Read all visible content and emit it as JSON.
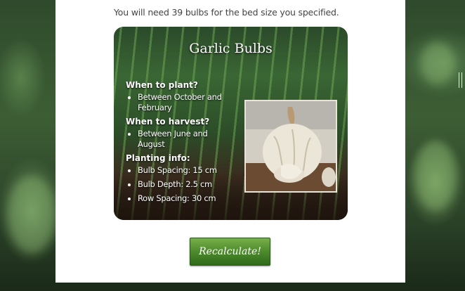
{
  "result": {
    "text": "You will need 39 bulbs for the bed size you specified."
  },
  "card": {
    "title": "Garlic Bulbs",
    "when_to_plant": {
      "heading": "When to plant?",
      "items": [
        "Between October and February"
      ]
    },
    "when_to_harvest": {
      "heading": "When to harvest?",
      "items": [
        "Between June and August"
      ]
    },
    "planting_info": {
      "heading": "Planting info:",
      "items": [
        "Bulb Spacing: 15 cm",
        "Bulb Depth: 2.5 cm",
        "Row Spacing: 30 cm"
      ]
    },
    "image_icon": "garlic-bulb-photo"
  },
  "actions": {
    "recalculate_label": "Recalculate!"
  },
  "colors": {
    "button_green": "#4c8a2c",
    "panel": "#ffffff",
    "text": "#444444"
  }
}
